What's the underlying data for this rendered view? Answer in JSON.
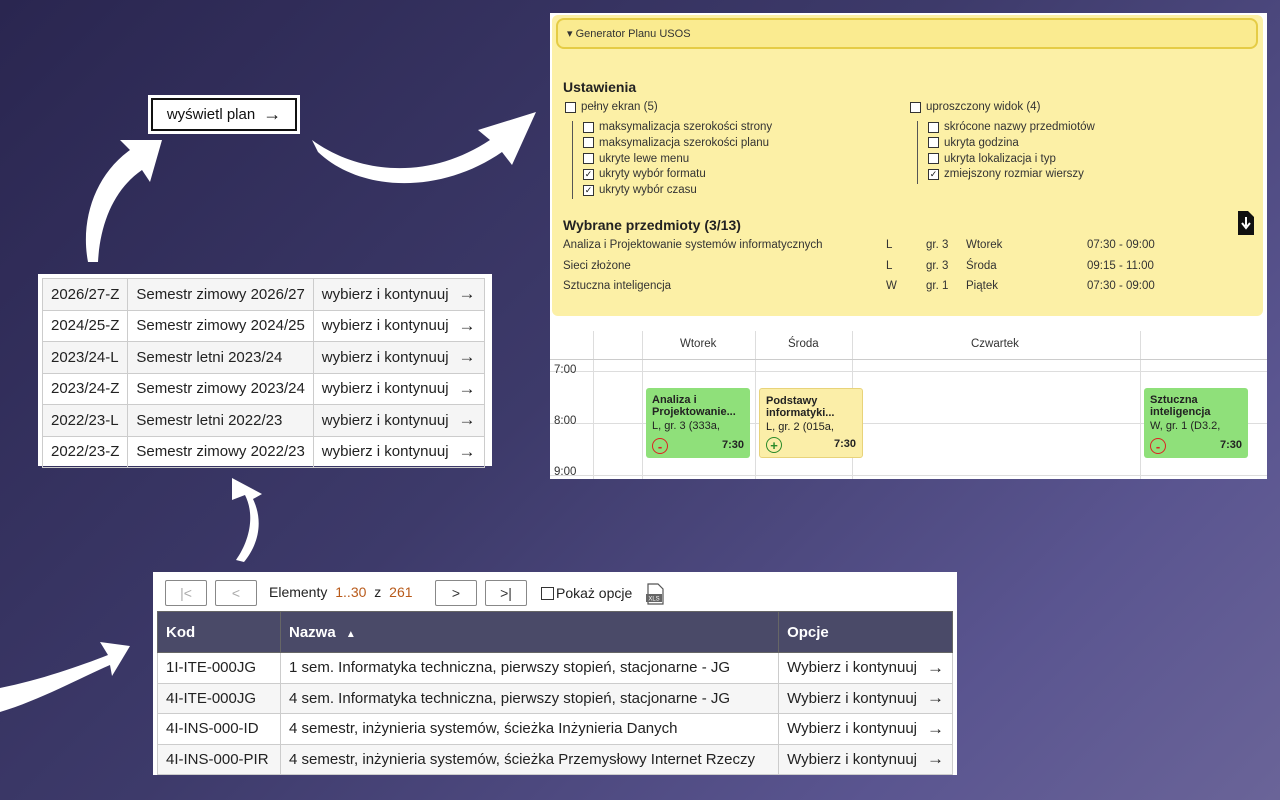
{
  "view_plan": {
    "label": "wyświetl plan",
    "arrow": "→"
  },
  "semesters": [
    {
      "code": "2026/27-Z",
      "name": "Semestr zimowy 2026/27",
      "action": "wybierz i kontynuuj"
    },
    {
      "code": "2024/25-Z",
      "name": "Semestr zimowy 2024/25",
      "action": "wybierz i kontynuuj"
    },
    {
      "code": "2023/24-L",
      "name": "Semestr letni 2023/24",
      "action": "wybierz i kontynuuj"
    },
    {
      "code": "2023/24-Z",
      "name": "Semestr zimowy 2023/24",
      "action": "wybierz i kontynuuj"
    },
    {
      "code": "2022/23-L",
      "name": "Semestr letni 2022/23",
      "action": "wybierz i kontynuuj"
    },
    {
      "code": "2022/23-Z",
      "name": "Semestr zimowy 2022/23",
      "action": "wybierz i kontynuuj"
    }
  ],
  "usos": {
    "summary": "▾ Generator Planu USOS",
    "settings_title": "Ustawienia",
    "group_left": {
      "label": "pełny ekran (5)",
      "checked": false,
      "items": [
        {
          "label": "maksymalizacja szerokości strony",
          "checked": false
        },
        {
          "label": "maksymalizacja szerokości planu",
          "checked": false
        },
        {
          "label": "ukryte lewe menu",
          "checked": false
        },
        {
          "label": "ukryty wybór formatu",
          "checked": true
        },
        {
          "label": "ukryty wybór czasu",
          "checked": true
        }
      ]
    },
    "group_right": {
      "label": "uproszczony widok (4)",
      "checked": false,
      "items": [
        {
          "label": "skrócone nazwy przedmiotów",
          "checked": false
        },
        {
          "label": "ukryta godzina",
          "checked": false
        },
        {
          "label": "ukryta lokalizacja i typ",
          "checked": false
        },
        {
          "label": "zmiejszony rozmiar wierszy",
          "checked": true
        }
      ]
    },
    "selected_title": "Wybrane przedmioty (3/13)",
    "download_icon": "download-file-icon",
    "subjects": [
      {
        "name": "Analiza i Projektowanie systemów informatycznych",
        "type": "L",
        "group": "gr. 3",
        "day": "Wtorek",
        "time": "07:30 - 09:00"
      },
      {
        "name": "Sieci złożone",
        "type": "L",
        "group": "gr. 3",
        "day": "Środa",
        "time": "09:15 - 11:00"
      },
      {
        "name": "Sztuczna inteligencja",
        "type": "W",
        "group": "gr. 1",
        "day": "Piątek",
        "time": "07:30 - 09:00"
      }
    ],
    "calendar": {
      "days": [
        "Wtorek",
        "Środa",
        "Czwartek"
      ],
      "hours": [
        "7:00",
        "8:00",
        "9:00"
      ],
      "events": [
        {
          "title": "Analiza i Projektowanie...",
          "sub": "L, gr. 3 (333a,",
          "time": "7:30",
          "button": "-",
          "color": "#8fe07a",
          "btn_color": "#d22"
        },
        {
          "title": "Podstawy informatyki...",
          "sub": "L, gr. 2 (015a,",
          "time": "7:30",
          "button": "+",
          "color": "#fbeea8",
          "btn_color": "#2a8a2a"
        },
        {
          "title": "Sztuczna inteligencja",
          "sub": "W, gr. 1 (D3.2,",
          "time": "7:30",
          "button": "-",
          "color": "#8fe07a",
          "btn_color": "#d22"
        }
      ]
    }
  },
  "programs": {
    "first_icon": "|<",
    "prev_icon": "<",
    "next_icon": ">",
    "last_icon": ">|",
    "elements_label": "Elementy",
    "range": "1..30",
    "of": "z",
    "total": "261",
    "show_options": "Pokaż opcje",
    "xls_icon": "xls-export-icon",
    "headers": {
      "code": "Kod",
      "name": "Nazwa",
      "sort": "▲",
      "options": "Opcje"
    },
    "rows": [
      {
        "code": "1I-ITE-000JG",
        "name": "1 sem. Informatyka techniczna, pierwszy stopień, stacjonarne - JG",
        "action": "Wybierz i kontynuuj"
      },
      {
        "code": "4I-ITE-000JG",
        "name": "4 sem. Informatyka techniczna, pierwszy stopień, stacjonarne - JG",
        "action": "Wybierz i kontynuuj"
      },
      {
        "code": "4I-INS-000-ID",
        "name": "4 semestr, inżynieria systemów, ścieżka Inżynieria Danych",
        "action": "Wybierz i kontynuuj"
      },
      {
        "code": "4I-INS-000-PIR",
        "name": "4 semestr, inżynieria systemów, ścieżka Przemysłowy Internet Rzeczy",
        "action": "Wybierz i kontynuuj"
      }
    ]
  }
}
